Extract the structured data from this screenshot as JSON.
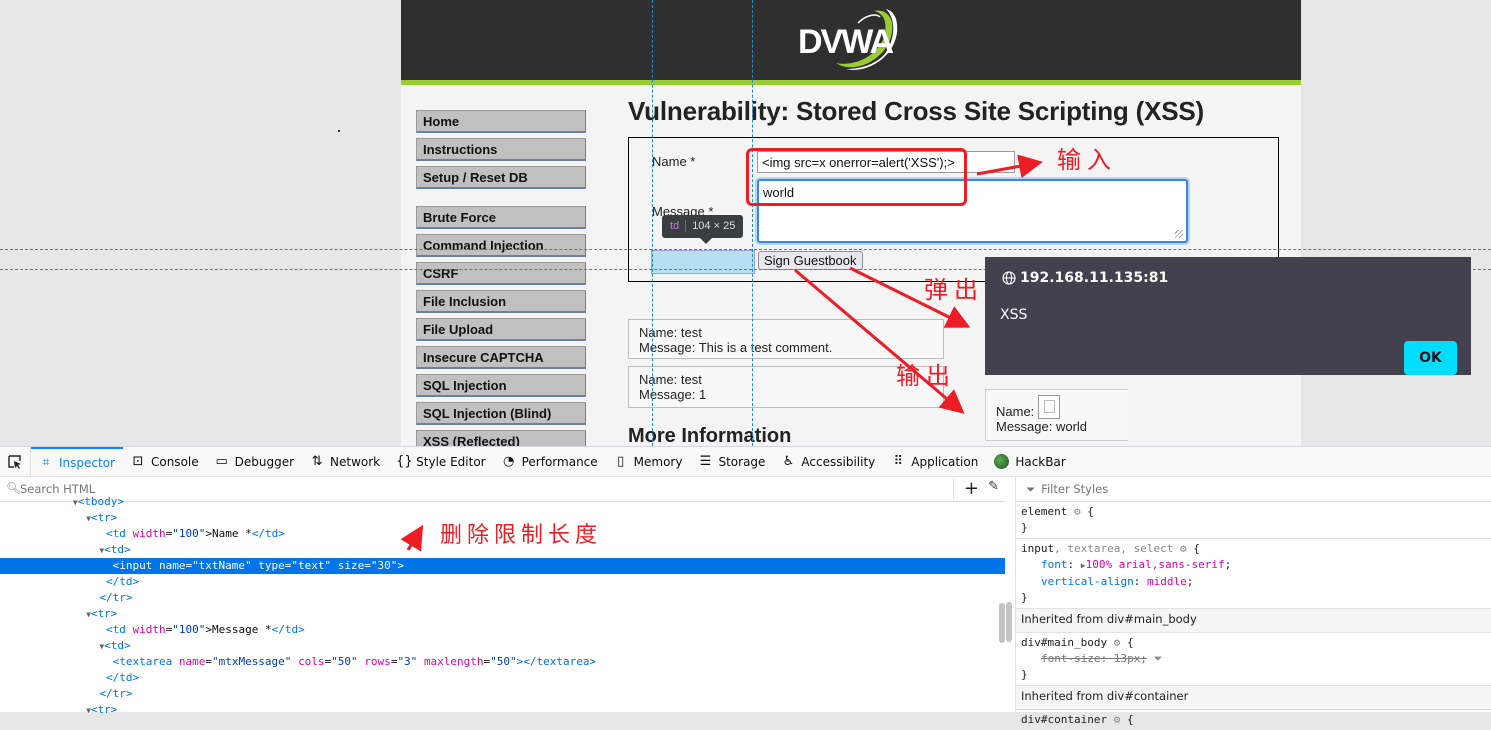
{
  "page": {
    "logo_text": "DVWA",
    "title": "Vulnerability: Stored Cross Site Scripting (XSS)",
    "menu": {
      "group1": [
        {
          "label": "Home"
        },
        {
          "label": "Instructions"
        },
        {
          "label": "Setup / Reset DB"
        }
      ],
      "group2": [
        {
          "label": "Brute Force"
        },
        {
          "label": "Command Injection"
        },
        {
          "label": "CSRF"
        },
        {
          "label": "File Inclusion"
        },
        {
          "label": "File Upload"
        },
        {
          "label": "Insecure CAPTCHA"
        },
        {
          "label": "SQL Injection"
        },
        {
          "label": "SQL Injection (Blind)"
        },
        {
          "label": "XSS (Reflected)"
        }
      ]
    },
    "form": {
      "name_label": "Name *",
      "message_label": "Message *",
      "name_value": "<img src=x onerror=alert('XSS');>",
      "message_value": "world",
      "submit_label": "Sign Guestbook"
    },
    "inspector_tooltip": {
      "tag": "td",
      "size": "104 × 25"
    },
    "entries": [
      {
        "name": "Name: test",
        "message": "Message: This is a test comment."
      },
      {
        "name": "Name: test",
        "message": "Message: 1"
      }
    ],
    "xss_entry": {
      "name": "Name:",
      "message": "Message: world"
    },
    "more_info": "More Information"
  },
  "alert": {
    "origin": "192.168.11.135:81",
    "message": "XSS",
    "ok_label": "OK"
  },
  "annotations": {
    "input": "输入",
    "popup": "弹出",
    "output": "输出",
    "remove_limit": "删除限制长度",
    "colors": {
      "annotation": "#ee1c25"
    }
  },
  "devtools": {
    "tabs": [
      {
        "label": "Inspector",
        "icon": "inspector-icon",
        "active": true
      },
      {
        "label": "Console",
        "icon": "console-icon"
      },
      {
        "label": "Debugger",
        "icon": "debugger-icon"
      },
      {
        "label": "Network",
        "icon": "network-icon"
      },
      {
        "label": "Style Editor",
        "icon": "style-editor-icon"
      },
      {
        "label": "Performance",
        "icon": "performance-icon"
      },
      {
        "label": "Memory",
        "icon": "memory-icon"
      },
      {
        "label": "Storage",
        "icon": "storage-icon"
      },
      {
        "label": "Accessibility",
        "icon": "accessibility-icon"
      },
      {
        "label": "Application",
        "icon": "application-icon"
      },
      {
        "label": "HackBar",
        "icon": "hackbar-icon"
      }
    ],
    "search_placeholder": "Search HTML",
    "filter_placeholder": "Filter Styles",
    "markup": {
      "tbody": "<tbody>",
      "tr_open": "<tr>",
      "td_close": "</td>",
      "tr_close": "</tr>",
      "row_name_td": {
        "attr": "width",
        "val": "\"100\"",
        "text": ">Name *"
      },
      "row_msg_td": {
        "attr": "width",
        "val": "\"100\"",
        "text": ">Message *"
      },
      "input_line": "<input name=\"txtName\" type=\"text\" size=\"30\">",
      "textarea": {
        "name": "\"mtxMessage\"",
        "cols": "\"50\"",
        "rows": "\"3\"",
        "maxlength": "\"50\""
      }
    },
    "rules": {
      "element": "element",
      "input_selector_main": "input",
      "input_selector_rest": ", textarea, select",
      "font_prop": "font",
      "font_val": "100% arial,sans-serif",
      "va_prop": "vertical-align",
      "va_val": "middle",
      "inherit_main": "Inherited from div#main_body",
      "main_body_selector": "div#main_body",
      "main_body_strike": "font-size: 13px;",
      "inherit_container": "Inherited from div#container",
      "container_selector": "div#container"
    }
  }
}
